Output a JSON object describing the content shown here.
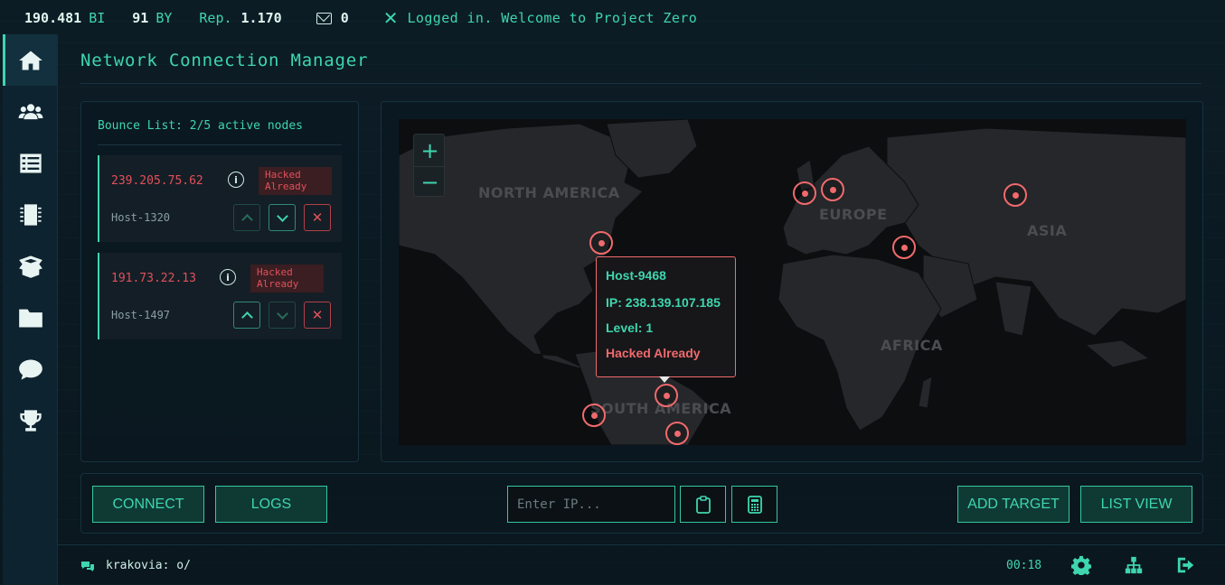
{
  "topbar": {
    "bi_value": "190.481",
    "bi_unit": "BI",
    "by_value": "91",
    "by_unit": "BY",
    "rep_label": "Rep.",
    "rep_value": "1.170",
    "mail_count": "0",
    "message": "Logged in. Welcome to Project Zero"
  },
  "sidebar": {
    "items": [
      {
        "icon": "home-icon",
        "active": true
      },
      {
        "icon": "users-icon"
      },
      {
        "icon": "list-icon"
      },
      {
        "icon": "chip-icon"
      },
      {
        "icon": "box-icon"
      },
      {
        "icon": "folder-icon"
      },
      {
        "icon": "chat-icon"
      },
      {
        "icon": "trophy-icon"
      }
    ]
  },
  "page": {
    "title": "Network Connection Manager"
  },
  "bounce": {
    "title": "Bounce List: 2/5 active nodes",
    "nodes": [
      {
        "ip": "239.205.75.62",
        "host": "Host-1320",
        "status": "Hacked Already"
      },
      {
        "ip": "191.73.22.13",
        "host": "Host-1497",
        "status": "Hacked Already"
      }
    ]
  },
  "map": {
    "zoom_in": "+",
    "zoom_out": "−",
    "regions": {
      "north_america": "NORTH AMERICA",
      "europe": "EUROPE",
      "asia": "ASIA",
      "africa": "AFRICA",
      "south_america": "SOUTH AMERICA"
    },
    "tooltip": {
      "host": "Host-9468",
      "ip": "IP: 238.139.107.185",
      "level": "Level: 1",
      "status": "Hacked Already"
    }
  },
  "actions": {
    "connect": "CONNECT",
    "logs": "LOGS",
    "ip_placeholder": "Enter IP...",
    "add_target": "ADD TARGET",
    "list_view": "LIST VIEW"
  },
  "footer": {
    "chat_text": "krakovia: o/",
    "clock": "00:18"
  },
  "colors": {
    "accent": "#3ed6ae",
    "danger": "#e2505a",
    "marker": "#f06a6d",
    "background": "#0b1a22"
  }
}
